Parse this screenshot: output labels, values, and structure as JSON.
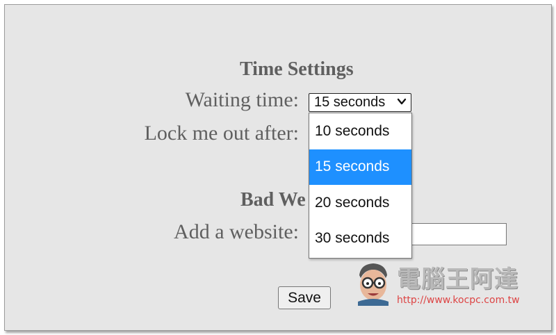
{
  "time_settings": {
    "heading": "Time Settings",
    "waiting_time_label": "Waiting time:",
    "lock_out_label": "Lock me out after:",
    "waiting_time_selected": "15 seconds",
    "waiting_time_options": [
      "10 seconds",
      "15 seconds",
      "20 seconds",
      "30 seconds"
    ]
  },
  "bad_websites": {
    "heading_visible": "Bad We",
    "add_website_label": "Add a website:",
    "add_website_value": ""
  },
  "actions": {
    "save_label": "Save"
  },
  "watermark": {
    "brand": "電腦王阿達",
    "url": "http://www.kocpc.com.tw"
  },
  "colors": {
    "panel_background": "#e6e6e6",
    "label_text": "#5f5f5f",
    "selected_option_background": "#1e90ff"
  },
  "icons": {
    "select_arrow": "chevron-down-icon",
    "watermark_logo": "cartoon-face-with-glasses-logo"
  }
}
